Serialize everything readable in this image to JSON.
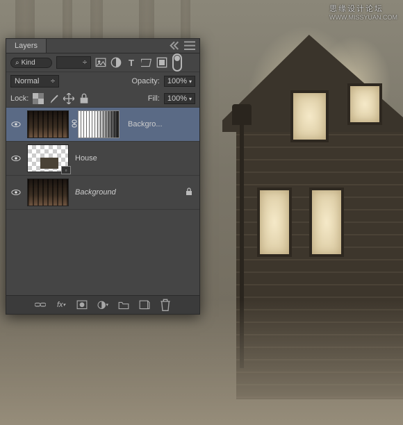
{
  "watermark": {
    "line1": "思缘设计论坛",
    "line2": "WWW.MISSYUAN.COM"
  },
  "panel": {
    "title": "Layers",
    "filter": {
      "search_placeholder": "Kind",
      "kind_label": "Kind"
    },
    "blend": {
      "mode": "Normal",
      "opacity_label": "Opacity:",
      "opacity_value": "100%"
    },
    "lock": {
      "label": "Lock:",
      "fill_label": "Fill:",
      "fill_value": "100%"
    },
    "layers": [
      {
        "name": "Backgro...",
        "visible": true,
        "has_mask": true,
        "selected": true,
        "italic": false,
        "locked": false,
        "thumb": "forest"
      },
      {
        "name": "House",
        "visible": true,
        "has_mask": false,
        "selected": false,
        "italic": false,
        "locked": false,
        "thumb": "checker",
        "smart": true
      },
      {
        "name": "Background",
        "visible": true,
        "has_mask": false,
        "selected": false,
        "italic": true,
        "locked": true,
        "thumb": "forest"
      }
    ]
  },
  "icons": {
    "search": "⌕",
    "dropdown": "÷",
    "image": "▭",
    "adjust": "◐",
    "type": "T",
    "shape": "▱",
    "smart": "◫",
    "artboard": "▥",
    "menu": "≡",
    "lock_trans": "▦",
    "lock_paint": "✎",
    "lock_pos": "✥",
    "lock_all": "🔒",
    "link": "⧉",
    "fx": "fx",
    "mask": "▣",
    "fill_circle": "�övern",
    "group": "▭",
    "new": "▣",
    "trash": "🗑",
    "eye": "👁",
    "chain": "⛓",
    "collapse": "«"
  }
}
